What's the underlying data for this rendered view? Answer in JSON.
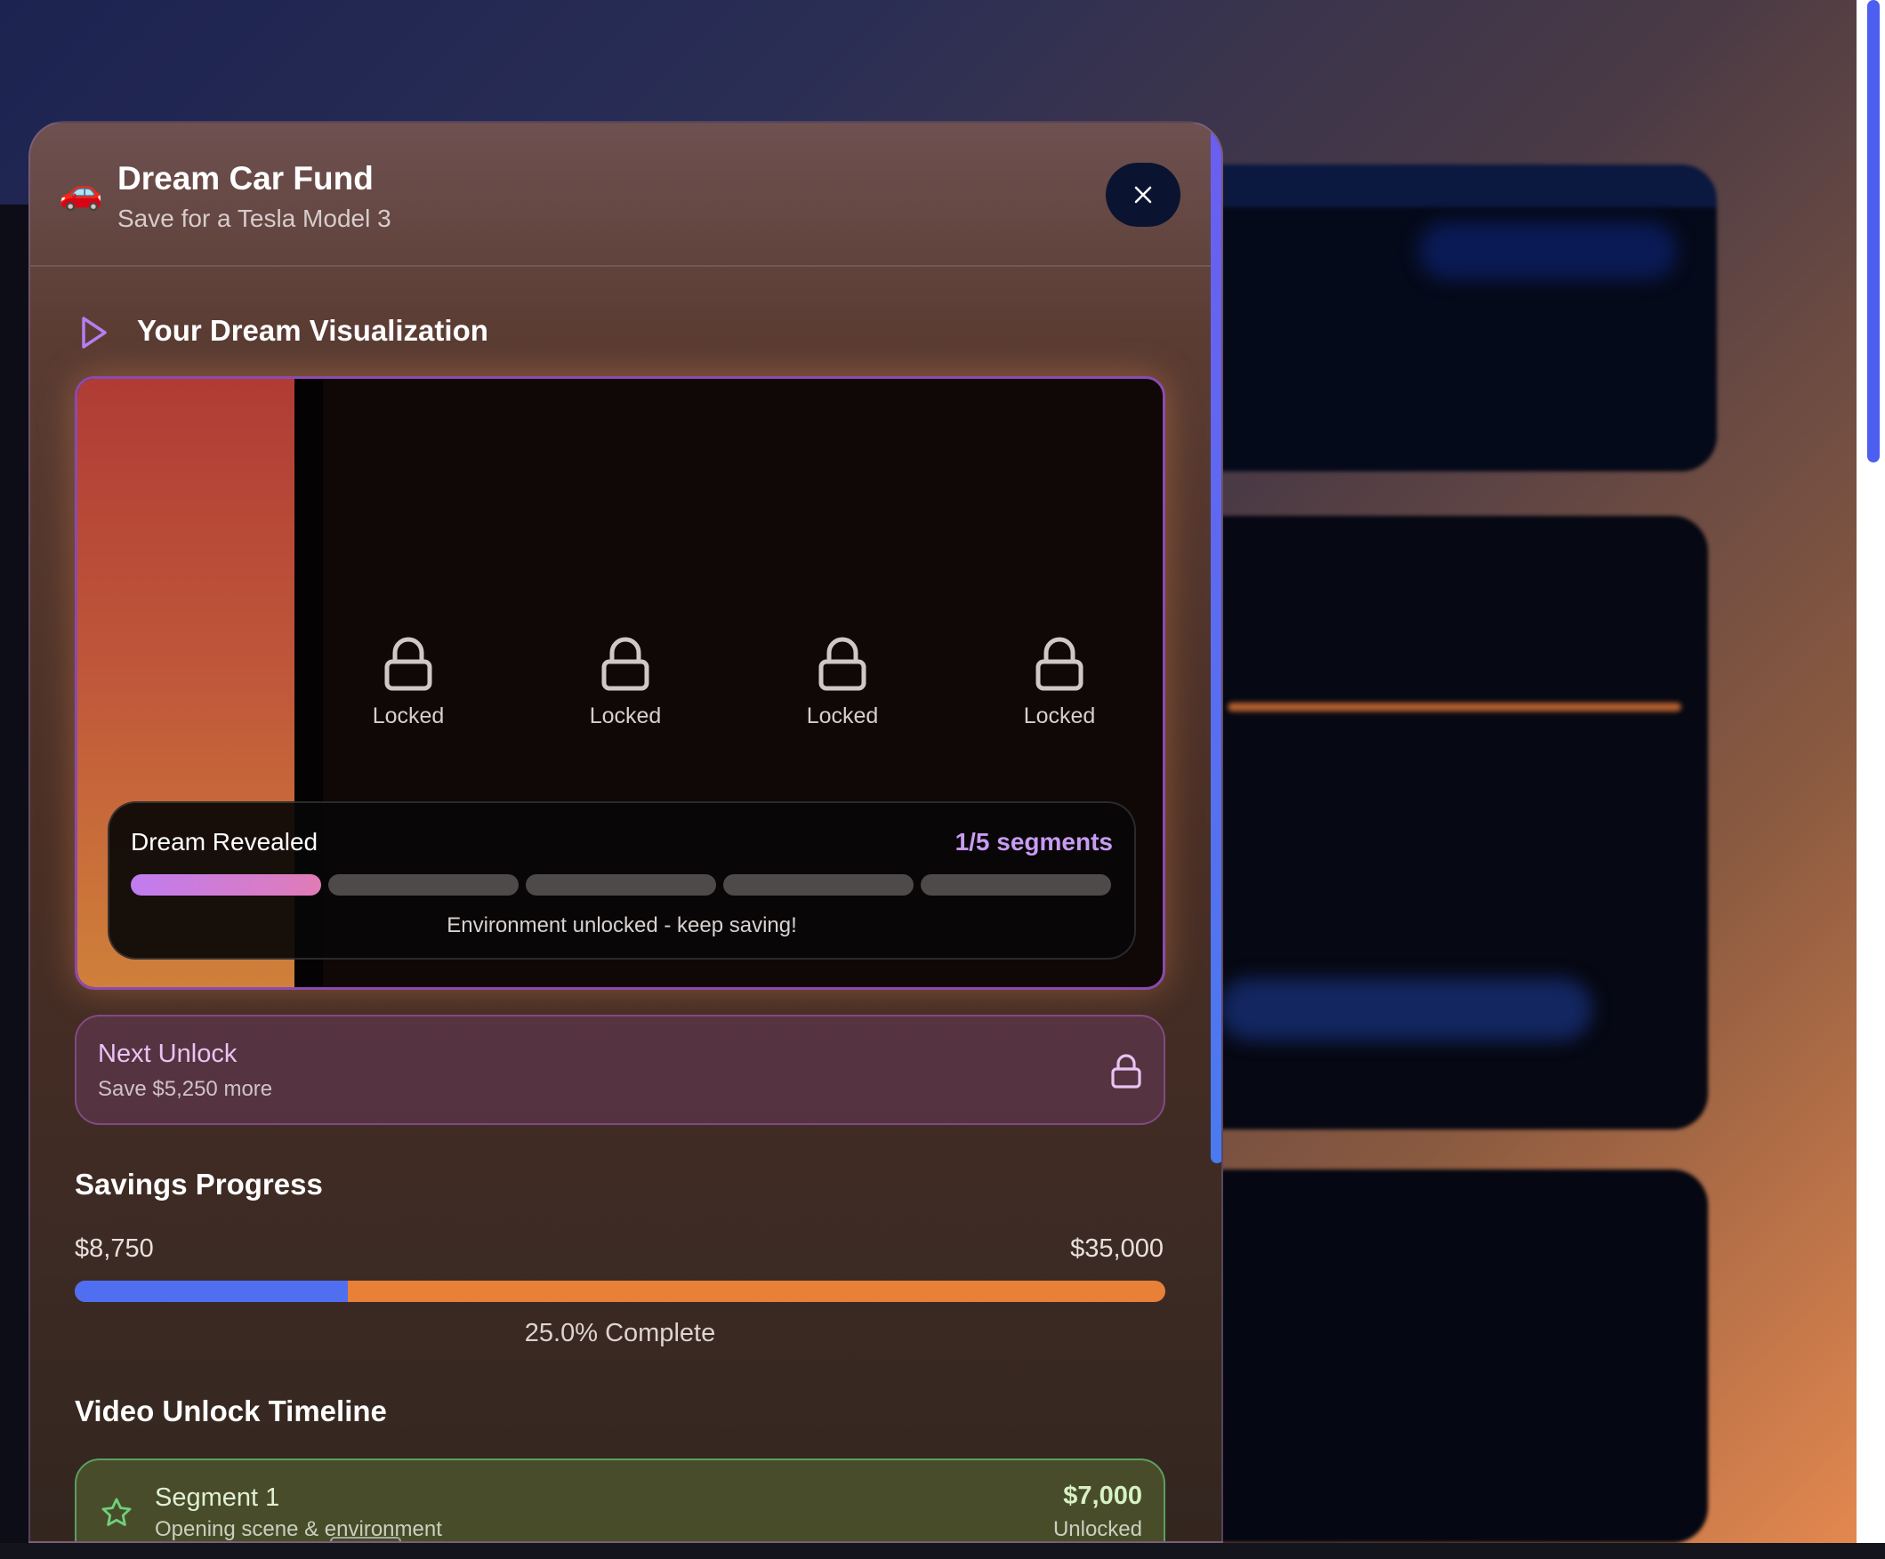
{
  "goal": {
    "emoji": "🚗",
    "title": "Dream Car Fund",
    "subtitle": "Save for a Tesla Model 3"
  },
  "visualization": {
    "heading": "Your Dream Visualization",
    "locked_label": "Locked",
    "locked_slots": [
      "Locked",
      "Locked",
      "Locked",
      "Locked"
    ],
    "reveal_label": "Dream Revealed",
    "reveal_count": "1/5 segments",
    "segments_total": 5,
    "segments_unlocked": 1,
    "message": "Environment unlocked - keep saving!"
  },
  "next_unlock": {
    "title": "Next Unlock",
    "subtitle": "Save $5,250 more"
  },
  "savings": {
    "heading": "Savings Progress",
    "saved": "$8,750",
    "target": "$35,000",
    "progress_fraction": 0.25,
    "percent_text": "25.0% Complete"
  },
  "timeline": {
    "heading": "Video Unlock Timeline",
    "items": [
      {
        "title": "Segment 1",
        "subtitle": "Opening scene & environment",
        "amount": "$7,000",
        "status": "Unlocked"
      }
    ]
  },
  "colors": {
    "accent_purple": "#c99bf4",
    "progress_blue": "#4f6ef0",
    "progress_orange": "#e88038",
    "success_green": "#5aa060"
  },
  "icons": [
    "car-emoji",
    "close-icon",
    "play-icon",
    "lock-icon",
    "star-icon"
  ]
}
